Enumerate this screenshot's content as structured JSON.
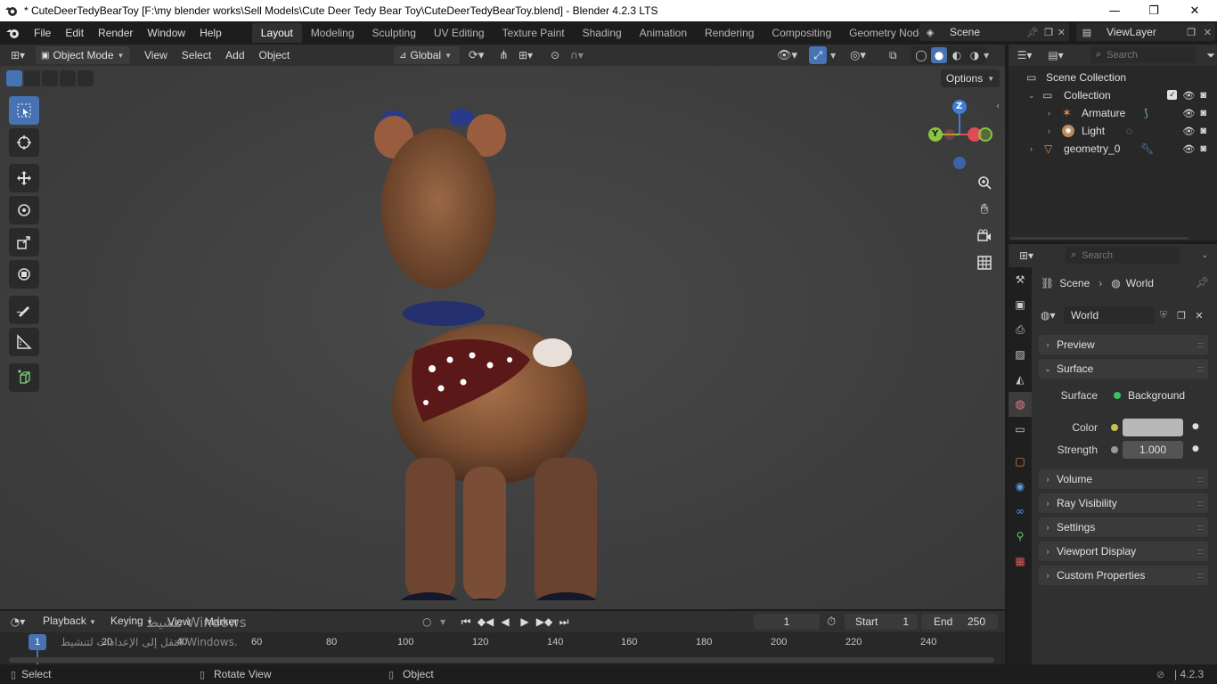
{
  "window": {
    "title": "* CuteDeerTedyBearToy [F:\\my blender works\\Sell Models\\Cute Deer Tedy Bear Toy\\CuteDeerTedyBearToy.blend] - Blender 4.2.3 LTS",
    "minimize": "—",
    "maximize": "❐",
    "close": "✕"
  },
  "menu": {
    "items": [
      "File",
      "Edit",
      "Render",
      "Window",
      "Help"
    ]
  },
  "workspaces": {
    "tabs": [
      "Layout",
      "Modeling",
      "Sculpting",
      "UV Editing",
      "Texture Paint",
      "Shading",
      "Animation",
      "Rendering",
      "Compositing",
      "Geometry Nodes"
    ],
    "active": "Layout"
  },
  "scene_selector": {
    "value": "Scene"
  },
  "viewlayer_selector": {
    "value": "ViewLayer"
  },
  "viewport_header": {
    "mode": "Object Mode",
    "menus": [
      "View",
      "Select",
      "Add",
      "Object"
    ],
    "orientation": "Global"
  },
  "viewport": {
    "options_label": "Options",
    "gizmo": {
      "z": "Z",
      "y": "Y"
    }
  },
  "outliner": {
    "search_placeholder": "Search",
    "rows": {
      "scene_collection": "Scene Collection",
      "collection": "Collection",
      "armature": "Armature",
      "light": "Light",
      "geometry": "geometry_0"
    }
  },
  "properties": {
    "search_placeholder": "Search",
    "breadcrumb": {
      "scene": "Scene",
      "world": "World"
    },
    "world_name": "World",
    "panels": {
      "preview": "Preview",
      "surface": "Surface",
      "volume": "Volume",
      "ray_visibility": "Ray Visibility",
      "settings": "Settings",
      "viewport_display": "Viewport Display",
      "custom_properties": "Custom Properties"
    },
    "surface": {
      "surface_label": "Surface",
      "surface_value": "Background",
      "color_label": "Color",
      "strength_label": "Strength",
      "strength_value": "1.000",
      "color_swatch": "#b8b8b8"
    }
  },
  "timeline": {
    "menus": [
      "Playback",
      "Keying",
      "View",
      "Marker"
    ],
    "current_frame": "1",
    "start_label": "Start",
    "start_value": "1",
    "end_label": "End",
    "end_value": "250",
    "ticks": [
      "20",
      "40",
      "60",
      "80",
      "100",
      "120",
      "140",
      "160",
      "180",
      "200",
      "220",
      "240"
    ],
    "playhead": "1"
  },
  "statusbar": {
    "select": "Select",
    "rotate": "Rotate View",
    "object": "Object",
    "version": "4.2.3"
  },
  "watermark": {
    "line1": "تنشيط Windows",
    "line2": "انتقل إلى الإعدادات لتنشيط Windows."
  },
  "colors": {
    "accent": "#4772b3",
    "axis_x": "#e14b57",
    "axis_y": "#8ac441",
    "axis_z": "#3f7ed6"
  }
}
